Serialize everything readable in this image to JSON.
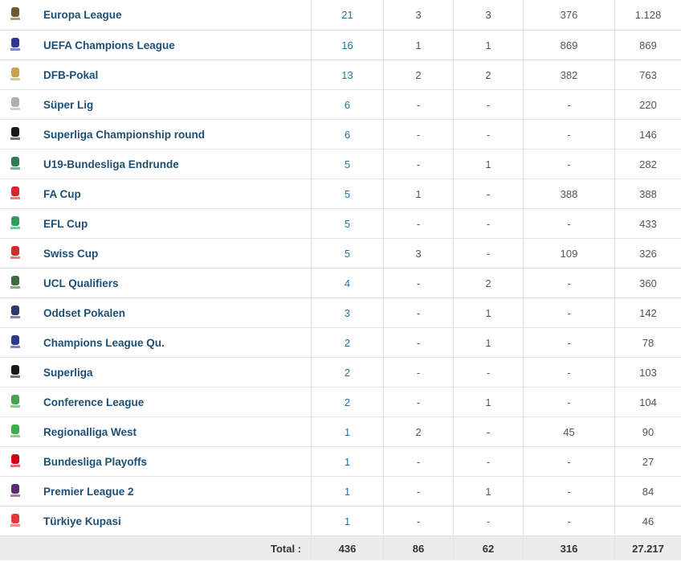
{
  "rows": [
    {
      "name": "Europa League",
      "logo": "europa-league-logo",
      "apps": "21",
      "goals": "3",
      "assists": "3",
      "c4": "376",
      "minutes": "1.128"
    },
    {
      "name": "UEFA Champions League",
      "logo": "champions-league-logo",
      "apps": "16",
      "goals": "1",
      "assists": "1",
      "c4": "869",
      "minutes": "869"
    },
    {
      "name": "DFB-Pokal",
      "logo": "dfb-pokal-logo",
      "apps": "13",
      "goals": "2",
      "assists": "2",
      "c4": "382",
      "minutes": "763"
    },
    {
      "name": "Süper Lig",
      "logo": "super-lig-logo",
      "apps": "6",
      "goals": "-",
      "assists": "-",
      "c4": "-",
      "minutes": "220"
    },
    {
      "name": "Superliga Championship round",
      "logo": "superliga-logo",
      "apps": "6",
      "goals": "-",
      "assists": "-",
      "c4": "-",
      "minutes": "146"
    },
    {
      "name": "U19-Bundesliga Endrunde",
      "logo": "u19-bundesliga-logo",
      "apps": "5",
      "goals": "-",
      "assists": "1",
      "c4": "-",
      "minutes": "282"
    },
    {
      "name": "FA Cup",
      "logo": "fa-cup-logo",
      "apps": "5",
      "goals": "1",
      "assists": "-",
      "c4": "388",
      "minutes": "388"
    },
    {
      "name": "EFL Cup",
      "logo": "efl-cup-logo",
      "apps": "5",
      "goals": "-",
      "assists": "-",
      "c4": "-",
      "minutes": "433"
    },
    {
      "name": "Swiss Cup",
      "logo": "swiss-cup-logo",
      "apps": "5",
      "goals": "3",
      "assists": "-",
      "c4": "109",
      "minutes": "326"
    },
    {
      "name": "UCL Qualifiers",
      "logo": "ucl-qualifiers-logo",
      "apps": "4",
      "goals": "-",
      "assists": "2",
      "c4": "-",
      "minutes": "360"
    },
    {
      "name": "Oddset Pokalen",
      "logo": "oddset-pokalen-logo",
      "apps": "3",
      "goals": "-",
      "assists": "1",
      "c4": "-",
      "minutes": "142"
    },
    {
      "name": "Champions League Qu.",
      "logo": "champions-league-qualifying-logo",
      "apps": "2",
      "goals": "-",
      "assists": "1",
      "c4": "-",
      "minutes": "78"
    },
    {
      "name": "Superliga",
      "logo": "superliga-logo",
      "apps": "2",
      "goals": "-",
      "assists": "-",
      "c4": "-",
      "minutes": "103"
    },
    {
      "name": "Conference League",
      "logo": "conference-league-logo",
      "apps": "2",
      "goals": "-",
      "assists": "1",
      "c4": "-",
      "minutes": "104"
    },
    {
      "name": "Regionalliga West",
      "logo": "regionalliga-west-logo",
      "apps": "1",
      "goals": "2",
      "assists": "-",
      "c4": "45",
      "minutes": "90"
    },
    {
      "name": "Bundesliga Playoffs",
      "logo": "bundesliga-logo",
      "apps": "1",
      "goals": "-",
      "assists": "-",
      "c4": "-",
      "minutes": "27"
    },
    {
      "name": "Premier League 2",
      "logo": "premier-league-2-logo",
      "apps": "1",
      "goals": "-",
      "assists": "1",
      "c4": "-",
      "minutes": "84"
    },
    {
      "name": "Türkiye Kupasi",
      "logo": "turkiye-kupasi-logo",
      "apps": "1",
      "goals": "-",
      "assists": "-",
      "c4": "-",
      "minutes": "46"
    }
  ],
  "total": {
    "label": "Total :",
    "apps": "436",
    "goals": "86",
    "assists": "62",
    "c4": "316",
    "minutes": "27.217"
  },
  "logo_colors": {
    "europa-league-logo": "#6b5a2e",
    "champions-league-logo": "#2b3a8f",
    "dfb-pokal-logo": "#c9a24a",
    "super-lig-logo": "#b0b0b0",
    "superliga-logo": "#1a1a1a",
    "u19-bundesliga-logo": "#2e7d4f",
    "fa-cup-logo": "#d6262b",
    "efl-cup-logo": "#2f9e5c",
    "swiss-cup-logo": "#d62b2b",
    "ucl-qualifiers-logo": "#3b6b3b",
    "oddset-pokalen-logo": "#2d3a6e",
    "champions-league-qualifying-logo": "#2b3a8f",
    "conference-league-logo": "#3ea54a",
    "regionalliga-west-logo": "#3cae4b",
    "bundesliga-logo": "#d20515",
    "premier-league-2-logo": "#5b2c6f",
    "turkiye-kupasi-logo": "#e03a3a"
  }
}
